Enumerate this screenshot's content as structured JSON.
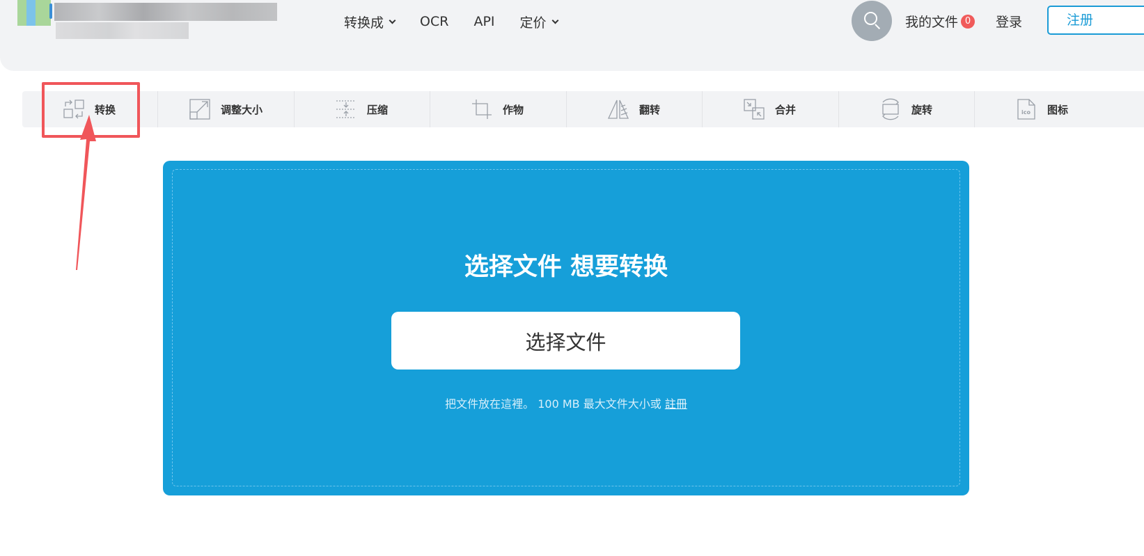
{
  "header": {
    "nav": [
      {
        "label": "转换成",
        "dropdown": true
      },
      {
        "label": "OCR",
        "dropdown": false
      },
      {
        "label": "API",
        "dropdown": false
      },
      {
        "label": "定价",
        "dropdown": true
      }
    ],
    "my_files_label": "我的文件",
    "my_files_count": "0",
    "login_label": "登录",
    "signup_label": "注册"
  },
  "toolbar": {
    "items": [
      {
        "label": "转换",
        "icon": "convert-icon"
      },
      {
        "label": "调整大小",
        "icon": "resize-icon"
      },
      {
        "label": "压缩",
        "icon": "compress-icon"
      },
      {
        "label": "作物",
        "icon": "crop-icon"
      },
      {
        "label": "翻转",
        "icon": "flip-icon"
      },
      {
        "label": "合并",
        "icon": "merge-icon"
      },
      {
        "label": "旋转",
        "icon": "rotate-icon"
      },
      {
        "label": "图标",
        "icon": "ico-icon"
      }
    ]
  },
  "upload": {
    "title": "选择文件 想要转换",
    "button_label": "选择文件",
    "hint_prefix": "把文件放在這裡。 100 MB 最大文件大小或",
    "hint_link": "註冊"
  },
  "colors": {
    "accent": "#1a9bd6",
    "panel": "#169fd9",
    "highlight": "#f0565a",
    "badge": "#f05a5a"
  }
}
